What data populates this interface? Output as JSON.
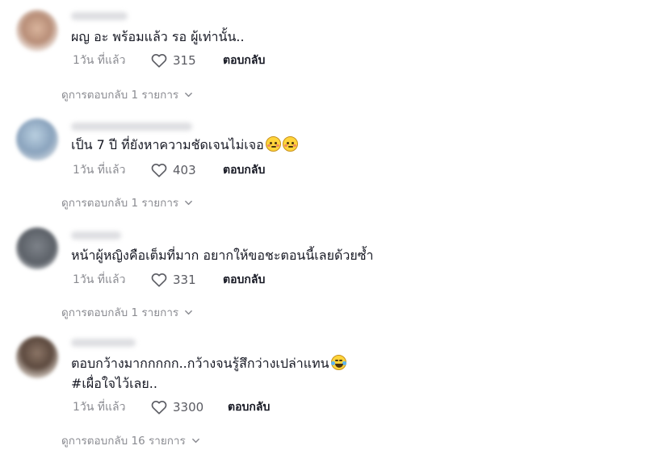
{
  "comments": [
    {
      "text_lines": [
        "ผญ อะ พร้อมแล้ว รอ ผู้เท่านั้น.."
      ],
      "time": "1วัน ที่แล้ว",
      "likes": "315",
      "reply_label": "ตอบกลับ",
      "view_replies": "ดูการตอบกลับ 1 รายการ"
    },
    {
      "text_lines": [
        "เป็น 7 ปี ที่ยังหาความชัดเจนไม่เจอ"
      ],
      "time": "1วัน ที่แล้ว",
      "likes": "403",
      "reply_label": "ตอบกลับ",
      "view_replies": "ดูการตอบกลับ 1 รายการ"
    },
    {
      "text_lines": [
        "หน้าผู้หญิงคือเต็มที่มาก อยากให้ขอชะตอนนี้เลยด้วยซ้ำ"
      ],
      "time": "1วัน ที่แล้ว",
      "likes": "331",
      "reply_label": "ตอบกลับ",
      "view_replies": "ดูการตอบกลับ 1 รายการ"
    },
    {
      "text_lines": [
        "ตอบกว้างมากกกกก..กว้างจนรู้สึกว่างเปล่าแทน",
        "#เผื่อใจไว้เลย.."
      ],
      "time": "1วัน ที่แล้ว",
      "likes": "3300",
      "reply_label": "ตอบกลับ",
      "view_replies": "ดูการตอบกลับ 16 รายการ"
    }
  ],
  "icons": {
    "like": "heart-outline-icon",
    "expand": "chevron-down-icon",
    "emoji_flushed": "flushed-face-emoji",
    "emoji_laugh": "tears-of-joy-emoji"
  },
  "colors": {
    "text": "#161823",
    "muted": "#8a8b91",
    "background": "#ffffff"
  }
}
